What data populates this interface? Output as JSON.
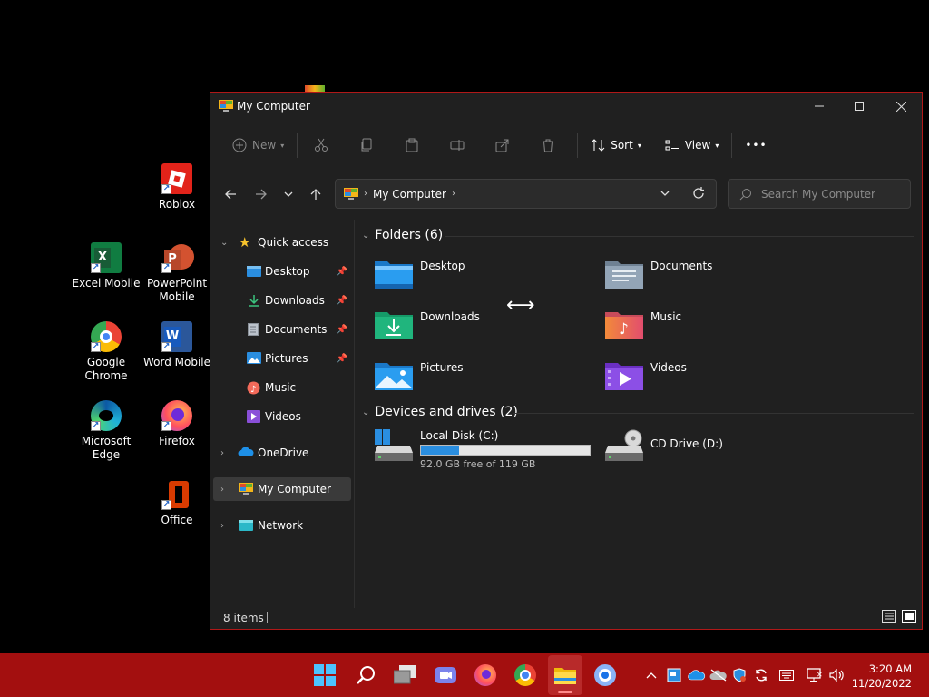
{
  "desktop": {
    "icons": [
      {
        "label": "Roblox"
      },
      {
        "label": "Excel Mobile"
      },
      {
        "label": "PowerPoint Mobile"
      },
      {
        "label": "Google Chrome"
      },
      {
        "label": "Word Mobile"
      },
      {
        "label": "Microsoft Edge"
      },
      {
        "label": "Firefox"
      },
      {
        "label": "Office"
      }
    ]
  },
  "window": {
    "title": "My Computer",
    "toolbar": {
      "new_label": "New",
      "sort_label": "Sort",
      "view_label": "View",
      "more_label": "•••"
    },
    "address": {
      "crumb": "My Computer",
      "search_placeholder": "Search My Computer"
    },
    "sidebar": {
      "items": [
        {
          "label": "Quick access"
        },
        {
          "label": "Desktop"
        },
        {
          "label": "Downloads"
        },
        {
          "label": "Documents"
        },
        {
          "label": "Pictures"
        },
        {
          "label": "Music"
        },
        {
          "label": "Videos"
        },
        {
          "label": "OneDrive"
        },
        {
          "label": "My Computer"
        },
        {
          "label": "Network"
        }
      ]
    },
    "folders_header": "Folders (6)",
    "folders": [
      {
        "name": "Desktop"
      },
      {
        "name": "Documents"
      },
      {
        "name": "Downloads"
      },
      {
        "name": "Music"
      },
      {
        "name": "Pictures"
      },
      {
        "name": "Videos"
      }
    ],
    "drives_header": "Devices and drives (2)",
    "drives": [
      {
        "name": "Local Disk (C:)",
        "free_text": "92.0 GB free of 119 GB",
        "used_fraction": 0.227
      },
      {
        "name": "CD Drive (D:)"
      }
    ],
    "status": {
      "items": "8 items"
    }
  },
  "taskbar": {
    "clock_time": "3:20 AM",
    "clock_date": "11/20/2022"
  },
  "colors": {
    "taskbar": "#a30f0f",
    "window_border": "#b01818",
    "window_bg": "#202020",
    "selection": "#3a3a3a",
    "progress": "#2a8ee0"
  }
}
